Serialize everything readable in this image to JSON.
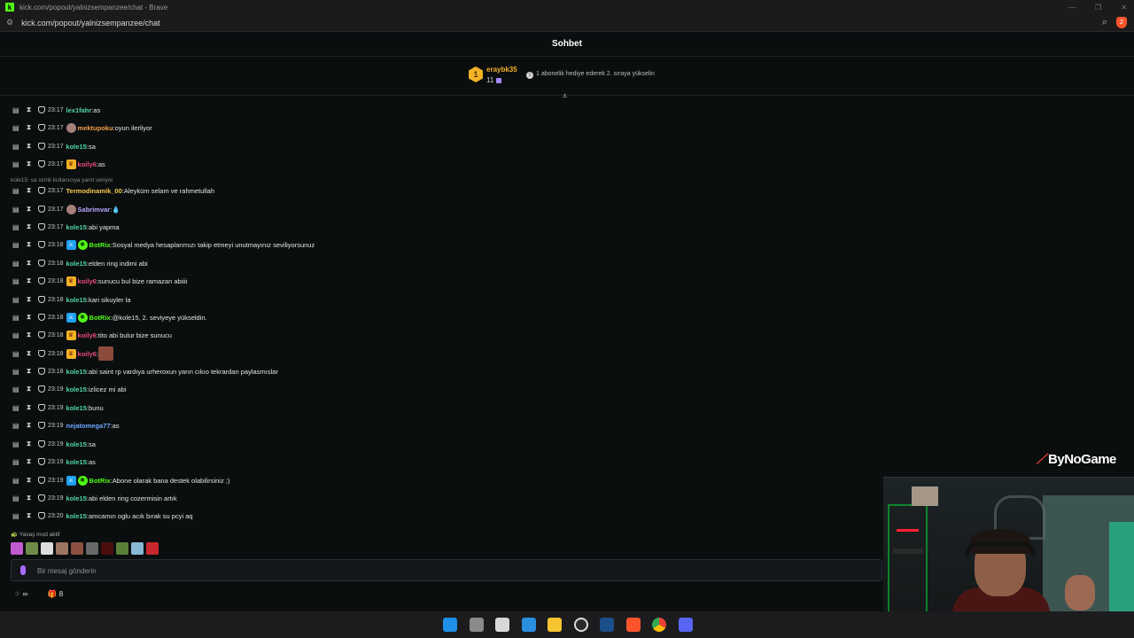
{
  "browser": {
    "tab_title": "kick.com/popout/yalnizsempanzee/chat - Brave",
    "url": "kick.com/popout/yalnizsempanzee/chat",
    "brave_badge": "2",
    "colors": {
      "brand": "#53fc18",
      "brave": "#fb542b"
    }
  },
  "chat": {
    "title": "Sohbet",
    "pinned": {
      "rank": "1",
      "user": "eraybk35",
      "count": "11",
      "message": "1 abonelik hediye ederek 2. sıraya yükselin"
    },
    "reply_hint": "kole15: sa isimli kullanıcıya yanıt veriyor",
    "messages": [
      {
        "time": "23:17",
        "badges": [],
        "user": "lex1fahr",
        "color": "#4fd6a8",
        "text": "as"
      },
      {
        "time": "23:17",
        "badges": [
          "avatar"
        ],
        "user": "mektupoku",
        "color": "#f0a04b",
        "text": "oyun ilerliyor"
      },
      {
        "time": "23:17",
        "badges": [],
        "user": "kole15",
        "color": "#4fd6a8",
        "text": "sa"
      },
      {
        "time": "23:17",
        "badges": [
          "crown"
        ],
        "user": "koily6",
        "color": "#e84a7f",
        "text": "as"
      },
      {
        "time": "23:17",
        "badges": [],
        "user": "Termodinamik_00",
        "color": "#f5c94e",
        "text": "Aleyküm selam ve rahmetullah"
      },
      {
        "time": "23:17",
        "badges": [
          "avatar"
        ],
        "user": "Sabrimvar",
        "color": "#b8a6ff",
        "text": "💧"
      },
      {
        "time": "23:17",
        "badges": [],
        "user": "kole15",
        "color": "#4fd6a8",
        "text": "abi yapma"
      },
      {
        "time": "23:18",
        "badges": [
          "mod",
          "bot"
        ],
        "user": "BotRix",
        "color": "#53fc18",
        "text": "Sosyal medya hesaplarımızı takip etmeyi unutmayınız seviliyorsunuz"
      },
      {
        "time": "23:18",
        "badges": [],
        "user": "kole15",
        "color": "#4fd6a8",
        "text": "elden ring indimi abi"
      },
      {
        "time": "23:18",
        "badges": [
          "crown"
        ],
        "user": "koily6",
        "color": "#e84a7f",
        "text": "sunucu bul bize ramazan abiiii"
      },
      {
        "time": "23:18",
        "badges": [],
        "user": "kole15",
        "color": "#4fd6a8",
        "text": "kari sikuyler la"
      },
      {
        "time": "23:18",
        "badges": [
          "mod",
          "bot"
        ],
        "user": "BotRix",
        "color": "#53fc18",
        "text": "@kole15, 2. seviyeye yükseldin."
      },
      {
        "time": "23:18",
        "badges": [
          "crown"
        ],
        "user": "koily6",
        "color": "#e84a7f",
        "text": "tito abi bulur bize sunucu"
      },
      {
        "time": "23:18",
        "badges": [
          "crown"
        ],
        "user": "koily6",
        "color": "#e84a7f",
        "text": "",
        "emote": true
      },
      {
        "time": "23:18",
        "badges": [],
        "user": "kole15",
        "color": "#4fd6a8",
        "text": "abi saint rp vardıya urheroxun yarın cıkıo tekrardan paylasmıslar"
      },
      {
        "time": "23:19",
        "badges": [],
        "user": "kole15",
        "color": "#4fd6a8",
        "text": "izlicez mi abi"
      },
      {
        "time": "23:19",
        "badges": [],
        "user": "kole15",
        "color": "#4fd6a8",
        "text": "bunu"
      },
      {
        "time": "23:19",
        "badges": [],
        "user": "nejatomega77",
        "color": "#6aa8ff",
        "text": "as"
      },
      {
        "time": "23:19",
        "badges": [],
        "user": "kole15",
        "color": "#4fd6a8",
        "text": "sa"
      },
      {
        "time": "23:19",
        "badges": [],
        "user": "kole15",
        "color": "#4fd6a8",
        "text": "as"
      },
      {
        "time": "23:19",
        "badges": [
          "mod",
          "bot"
        ],
        "user": "BotRix",
        "color": "#53fc18",
        "text": "Abone olarak bana destek olabilirsiniz ;)"
      },
      {
        "time": "23:19",
        "badges": [],
        "user": "kole15",
        "color": "#4fd6a8",
        "text": "abi elden ring cozermisin artık"
      },
      {
        "time": "23:20",
        "badges": [],
        "user": "kole15",
        "color": "#4fd6a8",
        "text": "amcamın oglu acık bırak su pcyi aq"
      }
    ],
    "slow_mode": "Yavaş mod aktif",
    "input_placeholder": "Bir mesaj gönderin",
    "footer": {
      "points_label": "∞",
      "gift_count": "8"
    }
  },
  "overlay": {
    "logo_text": "ByNoGame"
  },
  "taskbar": {
    "apps": [
      "windows-start",
      "task-view",
      "snipping-tool",
      "photos",
      "file-explorer",
      "obs",
      "steam",
      "brave",
      "chrome",
      "discord"
    ]
  }
}
